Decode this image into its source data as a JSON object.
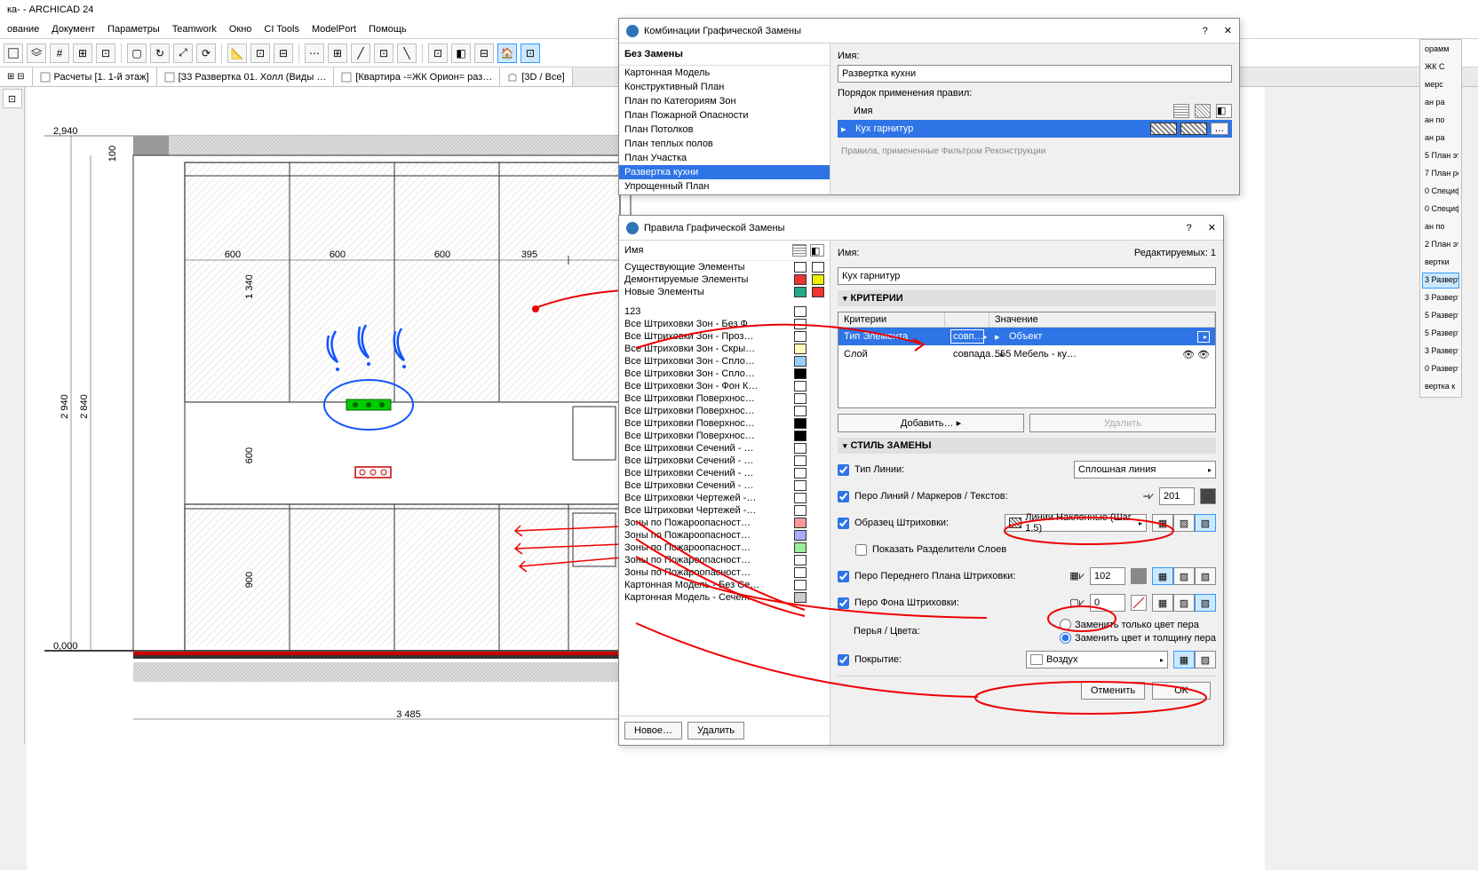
{
  "app": {
    "title": "ка- - ARCHICAD 24"
  },
  "menu": [
    "ование",
    "Документ",
    "Параметры",
    "Teamwork",
    "Окно",
    "CI Tools",
    "ModelPort",
    "Помощь"
  ],
  "tabs": [
    {
      "label": "Расчеты [1. 1-й этаж]"
    },
    {
      "label": "[З3 Развертка 01. Холл (Виды …"
    },
    {
      "label": "[Квартира -=ЖК Орион= раз…"
    },
    {
      "label": "[3D / Все]"
    }
  ],
  "combo_dlg": {
    "title": "Комбинации Графической Замены",
    "no_override": "Без Замены",
    "items": [
      "Картонная Модель",
      "Конструктивный План",
      "План по Категориям Зон",
      "План Пожарной Опасности",
      "План Потолков",
      "План теплых полов",
      "План Участка",
      "Развертка кухни",
      "Упрощенный План"
    ],
    "sel_idx": 7,
    "name_label": "Имя:",
    "name_value": "Развертка кухни",
    "order_label": "Порядок применения правил:",
    "col_name": "Имя",
    "rule_name": "Кух гарнитур",
    "hint": "Правила, примененные Фильтром Реконструкции"
  },
  "rules_dlg": {
    "title": "Правила Графической Замены",
    "col_name": "Имя",
    "editable": "Редактируемых: 1",
    "name_label": "Имя:",
    "name_value": "Кух гарнитур",
    "criteria_hd": "КРИТЕРИИ",
    "style_hd": "СТИЛЬ ЗАМЕНЫ",
    "crit_col1": "Критерии",
    "crit_col2": "Значение",
    "crit_rows": [
      {
        "c1": "Тип Элемента",
        "op": "совп…",
        "v": "Объект",
        "sel": true
      },
      {
        "c1": "Слой",
        "op": "совпада…",
        "v": "555 Мебель - ку…",
        "sel": false
      }
    ],
    "btn_add": "Добавить…",
    "btn_del": "Удалить",
    "items": [
      {
        "t": "Существующие Элементы",
        "c1": "#fff",
        "c2": "#fff"
      },
      {
        "t": "Демонтируемые Элементы",
        "c1": "#e33",
        "c2": "#ee0"
      },
      {
        "t": "Новые Элементы",
        "c1": "#2a8",
        "c2": "#e33"
      },
      {
        "t": "",
        "spacer": true
      },
      {
        "t": "123",
        "c1": "",
        "c2": ""
      },
      {
        "t": "Все Штриховки Зон - Без Ф…",
        "c1": "#fff",
        "c2": ""
      },
      {
        "t": "Все Штриховки Зон - Проз…",
        "c1": "#fff",
        "c2": ""
      },
      {
        "t": "Все Штриховки Зон - Скры…",
        "c1": "#ffb",
        "c2": ""
      },
      {
        "t": "Все Штриховки Зон - Спло…",
        "c1": "#9cf",
        "c2": ""
      },
      {
        "t": "Все Штриховки Зон - Спло…",
        "c1": "#000",
        "c2": ""
      },
      {
        "t": "Все Штриховки Зон - Фон К…",
        "c1": "#fff",
        "c2": ""
      },
      {
        "t": "Все Штриховки Поверхнос…",
        "c1": "#fff",
        "c2": ""
      },
      {
        "t": "Все Штриховки Поверхнос…",
        "c1": "#fff",
        "c2": ""
      },
      {
        "t": "Все Штриховки Поверхнос…",
        "c1": "#000",
        "c2": ""
      },
      {
        "t": "Все Штриховки Поверхнос…",
        "c1": "#000",
        "c2": ""
      },
      {
        "t": "Все Штриховки Сечений - …",
        "c1": "#fff",
        "c2": ""
      },
      {
        "t": "Все Штриховки Сечений - …",
        "c1": "#fff",
        "c2": ""
      },
      {
        "t": "Все Штриховки Сечений - …",
        "c1": "#fff",
        "c2": ""
      },
      {
        "t": "Все Штриховки Сечений - …",
        "c1": "#fff",
        "c2": ""
      },
      {
        "t": "Все Штриховки Чертежей -…",
        "c1": "#fff",
        "c2": ""
      },
      {
        "t": "Все Штриховки Чертежей -…",
        "c1": "#fff",
        "c2": ""
      },
      {
        "t": "Зоны по Пожароопасност…",
        "c1": "#f99",
        "c2": ""
      },
      {
        "t": "Зоны по Пожароопасност…",
        "c1": "#aaf",
        "c2": ""
      },
      {
        "t": "Зоны по Пожароопасност…",
        "c1": "#9e9",
        "c2": ""
      },
      {
        "t": "Зоны по Пожароопасност…",
        "c1": "#fff",
        "c2": ""
      },
      {
        "t": "Зоны по Пожароопасност…",
        "c1": "#fff",
        "c2": ""
      },
      {
        "t": "Картонная Модель - Без Се…",
        "c1": "#fff",
        "c2": ""
      },
      {
        "t": "Картонная Модель - Сечен…",
        "c1": "#ccc",
        "c2": ""
      }
    ],
    "btn_new": "Новое…",
    "btn_delete": "Удалить",
    "style": {
      "line_type_lb": "Тип Линии:",
      "line_type_v": "Сплошная линия",
      "line_pen_lb": "Перо Линий / Маркеров / Текстов:",
      "line_pen_v": "201",
      "fill_lb": "Образец Штриховки:",
      "fill_v": "Линии Наклонные (Шаг 1.5)",
      "show_sep": "Показать Разделители Слоев",
      "fg_pen_lb": "Перо Переднего Плана Штриховки:",
      "fg_pen_v": "102",
      "bg_pen_lb": "Перо Фона Штриховки:",
      "bg_pen_v": "0",
      "opt1": "Заменить только цвет пера",
      "opt2": "Заменить цвет и толщину пера",
      "pens_lb": "Перья / Цвета:",
      "surface_lb": "Покрытие:",
      "surface_v": "Воздух"
    },
    "btn_cancel": "Отменить",
    "btn_ok": "OK"
  },
  "rightbar": [
    "орамм",
    "ЖК С",
    "мерс",
    "ан ра",
    "ан по",
    "ан ра",
    "5 План эт",
    "7 План ре",
    "0 Специф",
    "0 Специф",
    "ан по",
    "2 План эт",
    "вертки",
    "3 Разверт",
    "3 Разверт",
    "5 Разверт",
    "5 Разверт",
    "3 Разверт",
    "0 Разверт",
    "вертка к"
  ],
  "rightbar_sel": 13,
  "dims": {
    "w": "2 940",
    "h": "2 840",
    "top": "1 340",
    "d1": "600",
    "d2": "600",
    "d3": "600",
    "d4": "395",
    "d5": "3 485",
    "d6": "900",
    "d7": "600",
    "org": "0,000",
    "lvl": "2,940",
    "d100": "100"
  }
}
